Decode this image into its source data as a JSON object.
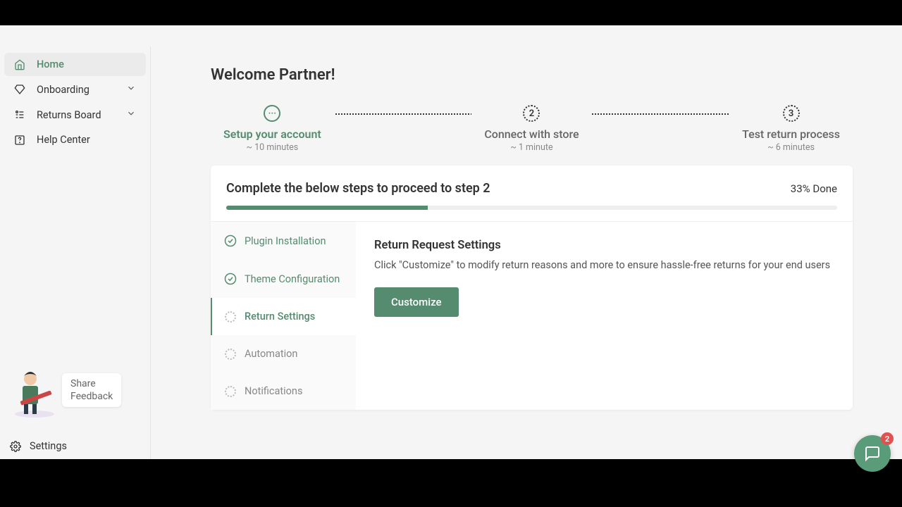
{
  "sidebar": {
    "items": [
      {
        "label": "Home",
        "active": true,
        "icon": "home",
        "expandable": false
      },
      {
        "label": "Onboarding",
        "active": false,
        "icon": "diamond",
        "expandable": true
      },
      {
        "label": "Returns Board",
        "active": false,
        "icon": "list",
        "expandable": true
      },
      {
        "label": "Help Center",
        "active": false,
        "icon": "help",
        "expandable": false
      }
    ],
    "feedback": {
      "line1": "Share",
      "line2": "Feedback"
    },
    "settings": "Settings"
  },
  "main": {
    "welcome": "Welcome Partner!",
    "stepper": [
      {
        "num": "···",
        "title": "Setup your account",
        "time": "~ 10 minutes",
        "active": true
      },
      {
        "num": "2",
        "title": "Connect with store",
        "time": "~ 1 minute",
        "active": false
      },
      {
        "num": "3",
        "title": "Test return process",
        "time": "~ 6 minutes",
        "active": false
      }
    ],
    "card": {
      "title": "Complete the below steps to proceed to step 2",
      "done": "33% Done",
      "progress": 33,
      "substeps": [
        {
          "label": "Plugin Installation",
          "state": "done"
        },
        {
          "label": "Theme Configuration",
          "state": "done"
        },
        {
          "label": "Return Settings",
          "state": "current"
        },
        {
          "label": "Automation",
          "state": "pending"
        },
        {
          "label": "Notifications",
          "state": "pending"
        }
      ],
      "detail": {
        "title": "Return Request Settings",
        "text": "Click \"Customize\" to modify return reasons and more to ensure hassle-free returns for your end users",
        "button": "Customize"
      }
    }
  },
  "chat": {
    "badge": "2"
  }
}
